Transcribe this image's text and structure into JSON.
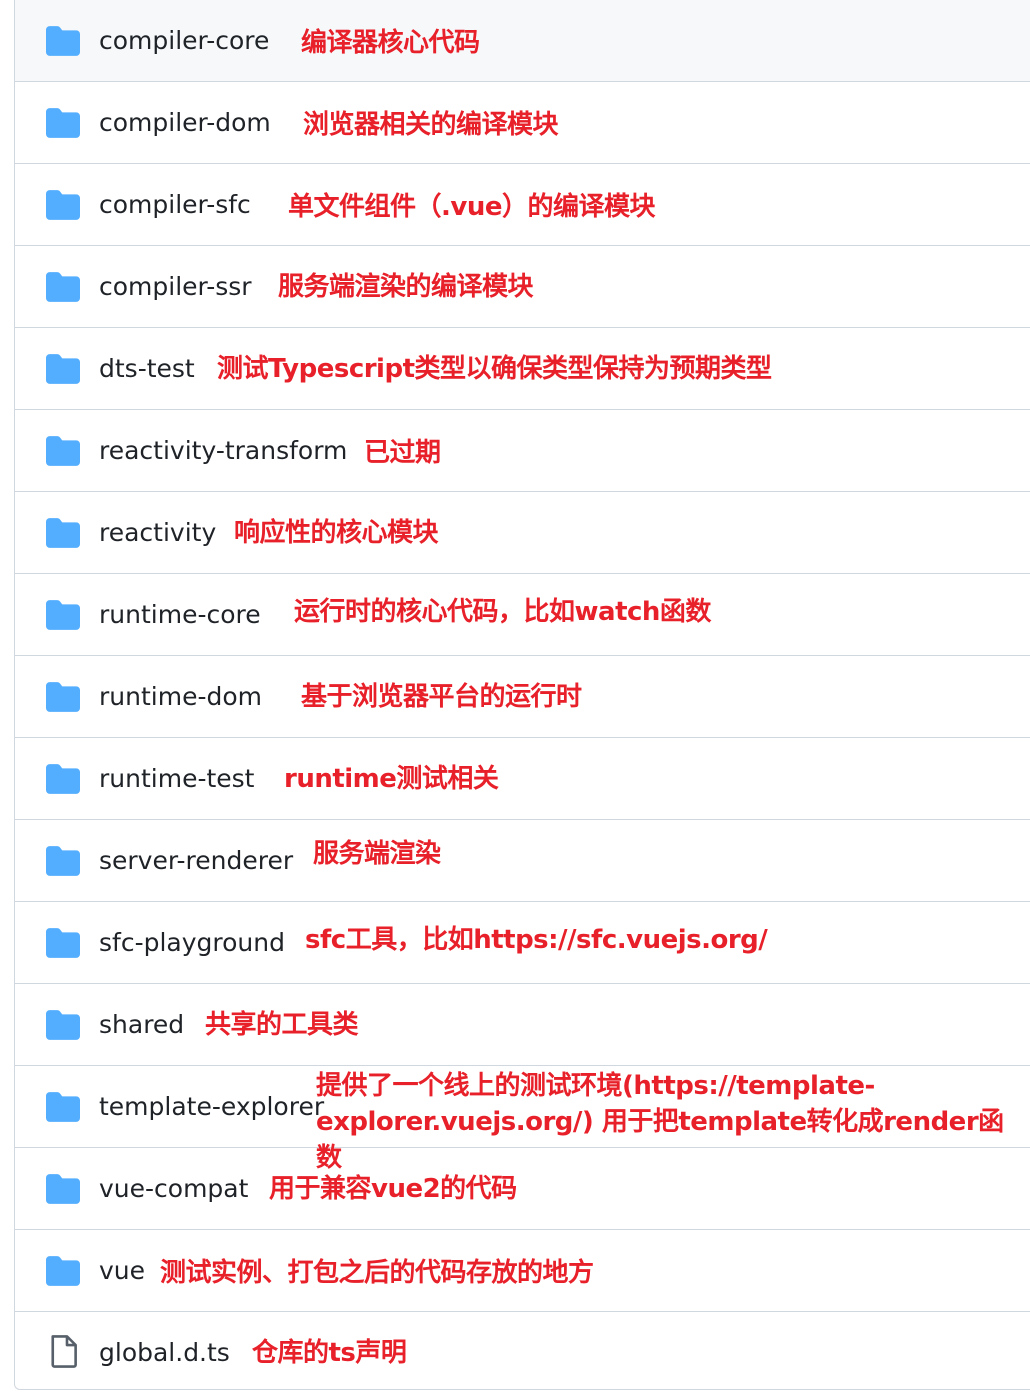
{
  "files": [
    {
      "name": "compiler-core",
      "type": "folder",
      "note": "编译器核心代码"
    },
    {
      "name": "compiler-dom",
      "type": "folder",
      "note": "浏览器相关的编译模块"
    },
    {
      "name": "compiler-sfc",
      "type": "folder",
      "note": "单文件组件（.vue）的编译模块"
    },
    {
      "name": "compiler-ssr",
      "type": "folder",
      "note": "服务端渲染的编译模块"
    },
    {
      "name": "dts-test",
      "type": "folder",
      "note": "测试Typescript类型以确保类型保持为预期类型"
    },
    {
      "name": "reactivity-transform",
      "type": "folder",
      "note": "已过期"
    },
    {
      "name": "reactivity",
      "type": "folder",
      "note": "响应性的核心模块"
    },
    {
      "name": "runtime-core",
      "type": "folder",
      "note": "运行时的核心代码，比如watch函数"
    },
    {
      "name": "runtime-dom",
      "type": "folder",
      "note": "基于浏览器平台的运行时"
    },
    {
      "name": "runtime-test",
      "type": "folder",
      "note": "runtime测试相关"
    },
    {
      "name": "server-renderer",
      "type": "folder",
      "note": "服务端渲染"
    },
    {
      "name": "sfc-playground",
      "type": "folder",
      "note": "sfc工具，比如https://sfc.vuejs.org/"
    },
    {
      "name": "shared",
      "type": "folder",
      "note": "共享的工具类"
    },
    {
      "name": "template-explorer",
      "type": "folder",
      "note": "提供了一个线上的测试环境(https://template-explorer.vuejs.org/) 用于把template转化成render函数"
    },
    {
      "name": "vue-compat",
      "type": "folder",
      "note": "用于兼容vue2的代码"
    },
    {
      "name": "vue",
      "type": "folder",
      "note": "测试实例、打包之后的代码存放的地方"
    },
    {
      "name": "global.d.ts",
      "type": "file",
      "note": "仓库的ts声明"
    }
  ],
  "colors": {
    "folder_icon": "#54aeff",
    "file_icon": "#57606a",
    "name_text": "#1f2328",
    "note_text": "#e8202a",
    "border": "#d0d7de",
    "first_row_bg": "#f6f8fa"
  },
  "icons": {
    "folder": "folder-icon",
    "file": "file-icon"
  }
}
